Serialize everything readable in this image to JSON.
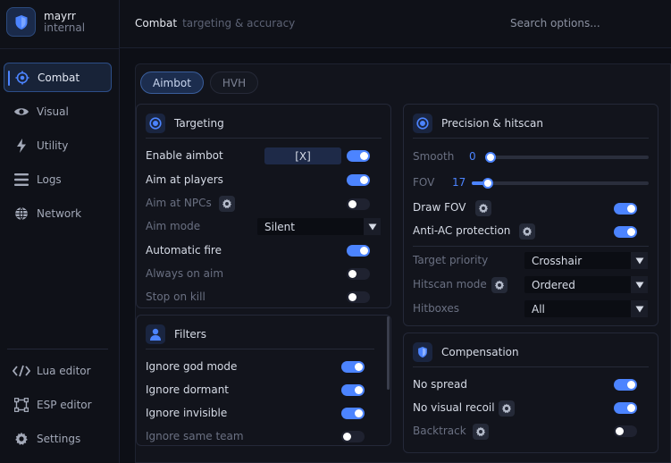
{
  "brand": {
    "name": "mayrr",
    "subtitle": "internal"
  },
  "nav": [
    {
      "label": "Combat",
      "icon": "crosshair-icon"
    },
    {
      "label": "Visual",
      "icon": "eye-icon"
    },
    {
      "label": "Utility",
      "icon": "bolt-icon"
    },
    {
      "label": "Logs",
      "icon": "list-icon"
    },
    {
      "label": "Network",
      "icon": "globe-icon"
    }
  ],
  "tools": [
    {
      "label": "Lua editor",
      "icon": "code-icon"
    },
    {
      "label": "ESP editor",
      "icon": "vector-square-icon"
    },
    {
      "label": "Settings",
      "icon": "gear-icon"
    }
  ],
  "header": {
    "section": "Combat",
    "subsection": "targeting & accuracy",
    "search_placeholder": "Search options..."
  },
  "tabs": [
    "Aimbot",
    "HVH"
  ],
  "colors": {
    "accent": "#4c84ff",
    "panel_bg": "#12141c",
    "app_bg": "#0d0f16"
  },
  "targeting": {
    "title": "Targeting",
    "enable_aimbot": {
      "label": "Enable aimbot",
      "keybind": "[X]",
      "on": true
    },
    "aim_players": {
      "label": "Aim at players",
      "on": true
    },
    "aim_npcs": {
      "label": "Aim at NPCs",
      "on": false
    },
    "aim_mode": {
      "label": "Aim mode",
      "value": "Silent"
    },
    "auto_fire": {
      "label": "Automatic fire",
      "on": true
    },
    "always_on": {
      "label": "Always on aim",
      "on": false
    },
    "stop_kill": {
      "label": "Stop on kill",
      "on": false
    }
  },
  "filters": {
    "title": "Filters",
    "god_mode": {
      "label": "Ignore god mode",
      "on": true
    },
    "dormant": {
      "label": "Ignore dormant",
      "on": true
    },
    "invisible": {
      "label": "Ignore invisible",
      "on": true
    },
    "same_team": {
      "label": "Ignore same team",
      "on": false
    }
  },
  "precision": {
    "title": "Precision & hitscan",
    "smooth": {
      "label": "Smooth",
      "value": "0",
      "fraction": 0.0
    },
    "fov": {
      "label": "FOV",
      "value": "17",
      "fraction": 0.06
    },
    "draw_fov": {
      "label": "Draw FOV",
      "on": true
    },
    "anti_ac": {
      "label": "Anti-AC protection",
      "on": true
    },
    "target_priority": {
      "label": "Target priority",
      "value": "Crosshair"
    },
    "hitscan_mode": {
      "label": "Hitscan mode",
      "value": "Ordered"
    },
    "hitboxes": {
      "label": "Hitboxes",
      "value": "All"
    }
  },
  "compensation": {
    "title": "Compensation",
    "no_spread": {
      "label": "No spread",
      "on": true
    },
    "no_visual_recoil": {
      "label": "No visual recoil",
      "on": true
    },
    "backtrack": {
      "label": "Backtrack",
      "on": false
    }
  }
}
